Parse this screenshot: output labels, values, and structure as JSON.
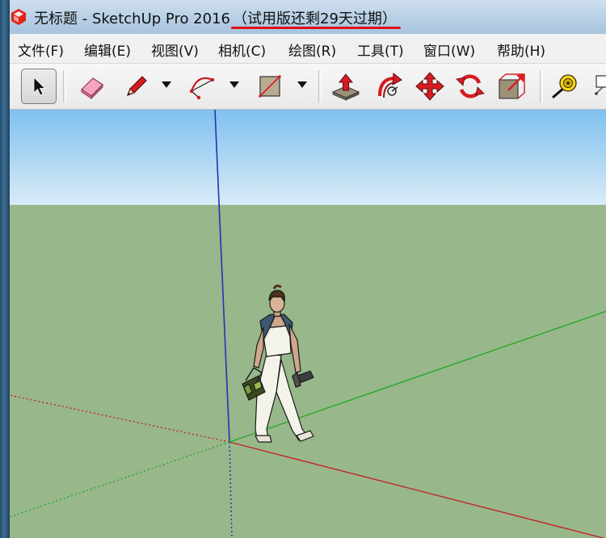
{
  "window": {
    "title": "无标题 - SketchUp Pro 2016",
    "trial_notice": "（试用版还剩29天过期）"
  },
  "menu": [
    {
      "label": "文件(F)"
    },
    {
      "label": "编辑(E)"
    },
    {
      "label": "视图(V)"
    },
    {
      "label": "相机(C)"
    },
    {
      "label": "绘图(R)"
    },
    {
      "label": "工具(T)"
    },
    {
      "label": "窗口(W)"
    },
    {
      "label": "帮助(H)"
    }
  ],
  "toolbar": {
    "tools": [
      "select",
      "eraser",
      "line",
      "arc",
      "rectangle",
      "push-pull",
      "follow-me",
      "move",
      "rotate",
      "scale",
      "tape-measure"
    ],
    "active_tool": "select"
  },
  "colors": {
    "sky_top": "#7fc0ef",
    "sky_bottom": "#d9ebf6",
    "ground": "#98b78a",
    "axis_red": "#c0262a",
    "axis_green": "#25a82d",
    "axis_blue": "#2233b6",
    "trial_underline": "#e0101a"
  }
}
